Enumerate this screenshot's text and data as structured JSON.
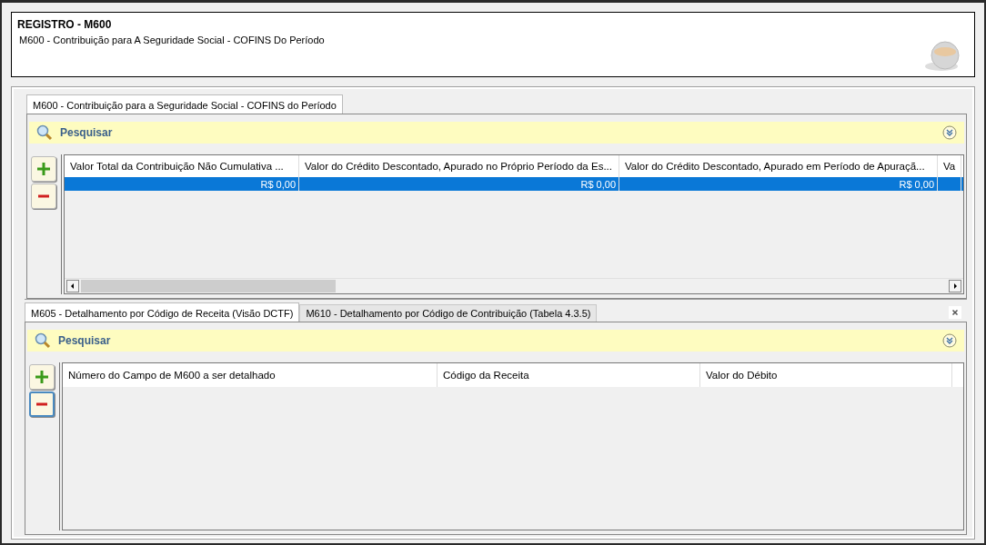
{
  "header": {
    "title": "REGISTRO - M600",
    "subtitle": "M600 - Contribuição para A Seguridade Social - COFINS Do Período"
  },
  "top": {
    "tabs": [
      {
        "label": "M600 - Contribuição para a Seguridade Social - COFINS do Período",
        "selected": true
      }
    ],
    "search": {
      "label": "Pesquisar"
    },
    "table": {
      "columns": [
        "Valor Total da Contribuição Não Cumulativa ...",
        "Valor do Crédito Descontado, Apurado no Próprio Período da Es...",
        "Valor do Crédito Descontado, Apurado em Período de Apuraçã...",
        "Va"
      ],
      "rows": [
        {
          "selected": true,
          "cells": [
            "R$ 0,00",
            "R$ 0,00",
            "R$ 0,00"
          ]
        }
      ]
    }
  },
  "bottom": {
    "tabs": [
      {
        "label": "M605 - Detalhamento por Código de Receita (Visão DCTF)",
        "selected": true
      },
      {
        "label": "M610 - Detalhamento por Código de Contribuição (Tabela 4.3.5)",
        "selected": false
      }
    ],
    "search": {
      "label": "Pesquisar"
    },
    "table": {
      "columns": [
        "Número do Campo de M600 a ser detalhado",
        "Código da Receita",
        "Valor do Débito"
      ]
    }
  }
}
